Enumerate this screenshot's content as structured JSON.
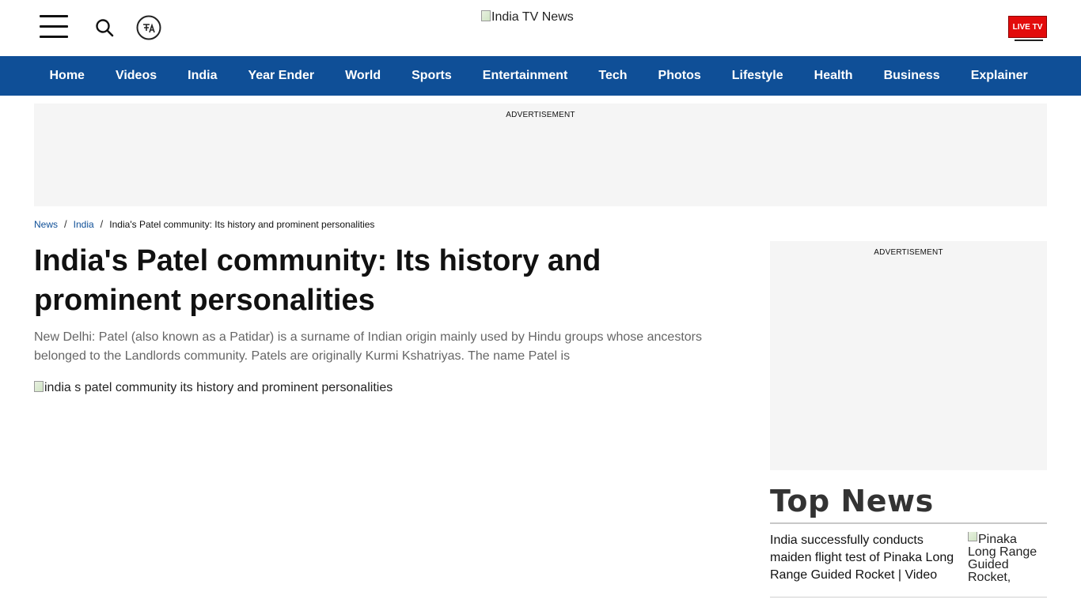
{
  "header": {
    "logo_alt": "India TV News",
    "live_tv_label": "LIVE TV"
  },
  "nav": {
    "items": [
      "Home",
      "Videos",
      "India",
      "Year Ender",
      "World",
      "Sports",
      "Entertainment",
      "Tech",
      "Photos",
      "Lifestyle",
      "Health",
      "Business",
      "Explainer"
    ]
  },
  "ads": {
    "top_label": "ADVERTISEMENT",
    "side_label": "ADVERTISEMENT"
  },
  "breadcrumb": {
    "items": [
      "News",
      "India"
    ],
    "current": "India's Patel community: Its history and prominent personalities"
  },
  "article": {
    "title": "India's Patel community: Its history and prominent personalities",
    "summary": "New Delhi: Patel (also known as a Patidar) is a surname of Indian origin mainly used by Hindu groups whose ancestors belonged to the Landlords community. Patels are originally Kurmi Kshatriyas. The name Patel is",
    "image_alt": "india s patel community its history and prominent personalities"
  },
  "top_news": {
    "heading": "Top News",
    "items": [
      {
        "headline": "India successfully conducts maiden flight test of Pinaka Long Range Guided Rocket | Video",
        "image_alt": "Pinaka Long Range Guided Rocket, DRDO"
      }
    ]
  },
  "colors": {
    "nav_bg": "#0f4f97",
    "live_tv_bg": "#e30b0b",
    "ad_bg": "#f5f5f5",
    "link": "#0f4f97"
  },
  "icons": [
    "hamburger-menu-icon",
    "search-icon",
    "language-switch-icon",
    "broken-image-icon"
  ]
}
